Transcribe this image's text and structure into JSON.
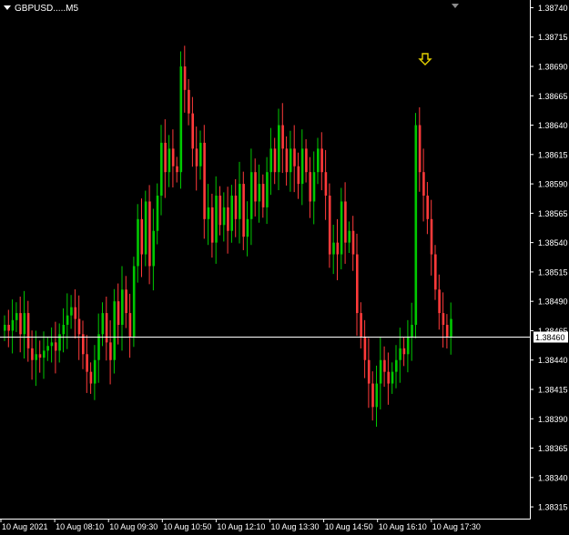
{
  "window": {
    "symbol_label": "GBPUSD.....M5"
  },
  "chart_data": {
    "type": "candlestick",
    "ylim": [
      1.38305,
      1.38745
    ],
    "y_ticks": [
      "1.38740",
      "1.38715",
      "1.38690",
      "1.38665",
      "1.38640",
      "1.38615",
      "1.38590",
      "1.38565",
      "1.38540",
      "1.38515",
      "1.38490",
      "1.38465",
      "1.38440",
      "1.38415",
      "1.38390",
      "1.38365",
      "1.38340",
      "1.38315"
    ],
    "x_ticks": [
      "10 Aug 2021",
      "10 Aug 08:10",
      "10 Aug 09:30",
      "10 Aug 10:50",
      "10 Aug 12:10",
      "10 Aug 13:30",
      "10 Aug 14:50",
      "10 Aug 16:10",
      "10 Aug 17:30"
    ],
    "current_price": "1.38460",
    "colors": {
      "up": "#00c800",
      "down": "#ff3a3a",
      "grid_line": "#ffffff",
      "arrow": "#e6d200"
    },
    "arrow_marker": {
      "icon": "down-arrow-icon",
      "price": 1.3869
    },
    "candles_close": [
      1.3847,
      1.38465,
      1.38474,
      1.3848,
      1.38462,
      1.3848,
      1.3845,
      1.3844,
      1.38445,
      1.38442,
      1.38448,
      1.38452,
      1.38455,
      1.38448,
      1.38462,
      1.3847,
      1.38478,
      1.38485,
      1.38475,
      1.38462,
      1.38445,
      1.3843,
      1.3842,
      1.3844,
      1.38462,
      1.3848,
      1.38455,
      1.3844,
      1.3849,
      1.3847,
      1.385,
      1.3848,
      1.3846,
      1.3852,
      1.3856,
      1.3853,
      1.38575,
      1.3852,
      1.3855,
      1.3858,
      1.38625,
      1.386,
      1.3862,
      1.38605,
      1.386,
      1.3869,
      1.3867,
      1.3865,
      1.3862,
      1.38605,
      1.38625,
      1.3856,
      1.3857,
      1.3854,
      1.3858,
      1.38555,
      1.3857,
      1.3855,
      1.3858,
      1.3856,
      1.3859,
      1.38545,
      1.3856,
      1.386,
      1.38575,
      1.3859,
      1.3857,
      1.386,
      1.3862,
      1.386,
      1.3864,
      1.3862,
      1.386,
      1.3862,
      1.38605,
      1.3859,
      1.3862,
      1.386,
      1.38575,
      1.386,
      1.3862,
      1.386,
      1.3858,
      1.3853,
      1.3854,
      1.3853,
      1.38575,
      1.3854,
      1.3855,
      1.3853,
      1.3848,
      1.3846,
      1.3844,
      1.3842,
      1.384,
      1.3842,
      1.3844,
      1.3843,
      1.3842,
      1.3843,
      1.3844,
      1.3845,
      1.38445,
      1.3846,
      1.3847,
      1.3864,
      1.386,
      1.3858,
      1.3856,
      1.3853,
      1.385,
      1.3848,
      1.3847,
      1.3846,
      1.38475
    ]
  }
}
